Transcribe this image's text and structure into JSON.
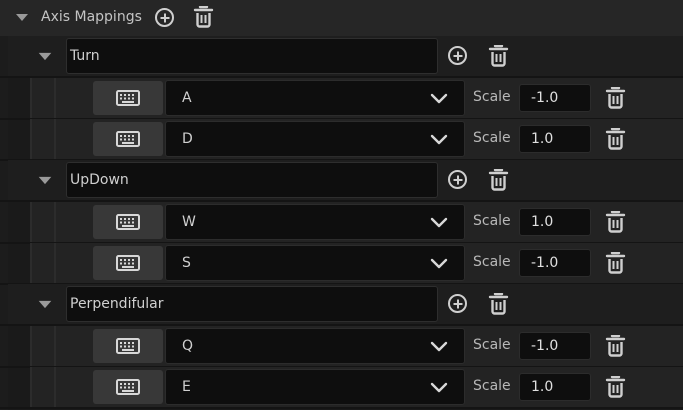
{
  "header": {
    "title": "Axis Mappings"
  },
  "groups": [
    {
      "name": "Turn",
      "keys": [
        {
          "key": "A",
          "scale_label": "Scale",
          "scale": "-1.0"
        },
        {
          "key": "D",
          "scale_label": "Scale",
          "scale": "1.0"
        }
      ]
    },
    {
      "name": "UpDown",
      "keys": [
        {
          "key": "W",
          "scale_label": "Scale",
          "scale": "1.0"
        },
        {
          "key": "S",
          "scale_label": "Scale",
          "scale": "-1.0"
        }
      ]
    },
    {
      "name": "Perpendifular",
      "keys": [
        {
          "key": "Q",
          "scale_label": "Scale",
          "scale": "-1.0"
        },
        {
          "key": "E",
          "scale_label": "Scale",
          "scale": "1.0"
        }
      ]
    }
  ],
  "icons": {
    "collapse": "triangle-down-icon",
    "add": "circle-plus-icon",
    "remove": "trash-icon",
    "keyboard": "keyboard-icon",
    "dropdown": "chevron-down-icon"
  },
  "colors": {
    "background": "#1a1a1a",
    "panel": "#262626",
    "input": "#0e0e0e",
    "text": "#d0d0d0"
  }
}
